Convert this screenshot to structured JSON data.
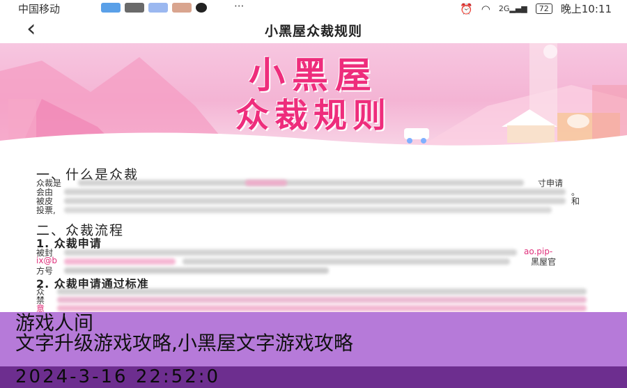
{
  "status_bar": {
    "carrier": "中国移动",
    "more": "···",
    "signal": "2G",
    "battery": "72",
    "time": "晚上10:11",
    "app_icon_colors": [
      "#5aa0e8",
      "#6a6a6a",
      "#9bb8f0",
      "#d9a58f",
      "#222222"
    ]
  },
  "nav": {
    "back_icon": "‹",
    "title": "小黑屋众裁规则"
  },
  "banner": {
    "line1": "小黑屋",
    "line2": "众裁规则",
    "accent": "#ee2d7c"
  },
  "content": {
    "section1": "一、什么是众裁",
    "s1_lines": [
      {
        "lead": "众裁是",
        "tail": "寸申请"
      },
      {
        "lead": "会由",
        "tail": "。"
      },
      {
        "lead": "被皮",
        "tail": "和"
      },
      {
        "lead": "投票,",
        "tail": ""
      }
    ],
    "section2": "二、众裁流程",
    "sub1": "1. 众裁申请",
    "s2_lines": [
      {
        "lead": "被封",
        "tail": "ao.pip-"
      },
      {
        "lead": "ix@b",
        "tail": "黑屋官"
      },
      {
        "lead": "方号",
        "tail": ""
      }
    ],
    "sub2": "2. 众裁申请通过标准",
    "s3_lines": [
      {
        "lead": "众",
        "tail": ""
      },
      {
        "lead": "禁",
        "tail": ""
      },
      {
        "lead": "意",
        "tail": ""
      }
    ]
  },
  "overlay": {
    "title": "游戏人间",
    "subtitle": "文字升级游戏攻略,小黑屋文字游戏攻略",
    "timestamp": "2024-3-16 22:52:0",
    "bg": "#b67ad9",
    "band": "#6d2e8f"
  }
}
